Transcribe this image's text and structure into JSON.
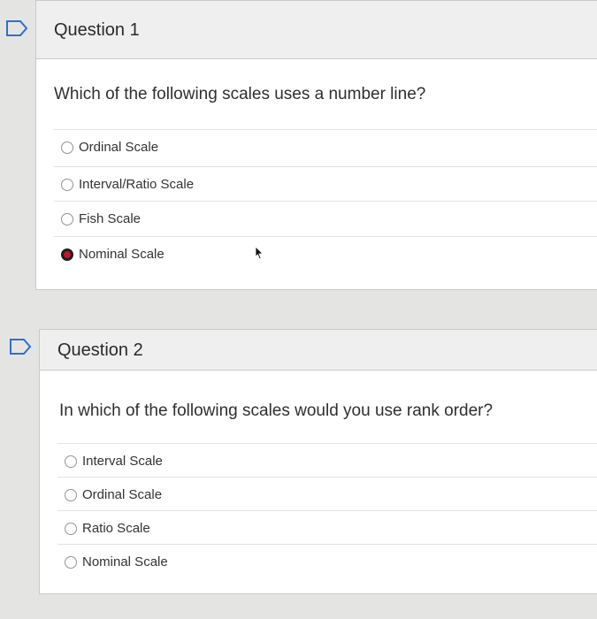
{
  "questions": [
    {
      "title": "Question 1",
      "prompt": "Which of the following scales uses a number line?",
      "options": [
        {
          "label": "Ordinal Scale",
          "selected": false
        },
        {
          "label": "Interval/Ratio Scale",
          "selected": false
        },
        {
          "label": "Fish Scale",
          "selected": false
        },
        {
          "label": "Nominal Scale",
          "selected": true
        }
      ]
    },
    {
      "title": "Question 2",
      "prompt": "In which of the following scales would you use rank order?",
      "options": [
        {
          "label": "Interval Scale",
          "selected": false
        },
        {
          "label": "Ordinal Scale",
          "selected": false
        },
        {
          "label": "Ratio Scale",
          "selected": false
        },
        {
          "label": "Nominal Scale",
          "selected": false
        }
      ]
    }
  ],
  "icons": {
    "flag": "flag-icon",
    "cursor": "mouse-pointer-icon"
  },
  "colors": {
    "selected_radio": "#c4152d",
    "header_bg": "#eeefee"
  }
}
